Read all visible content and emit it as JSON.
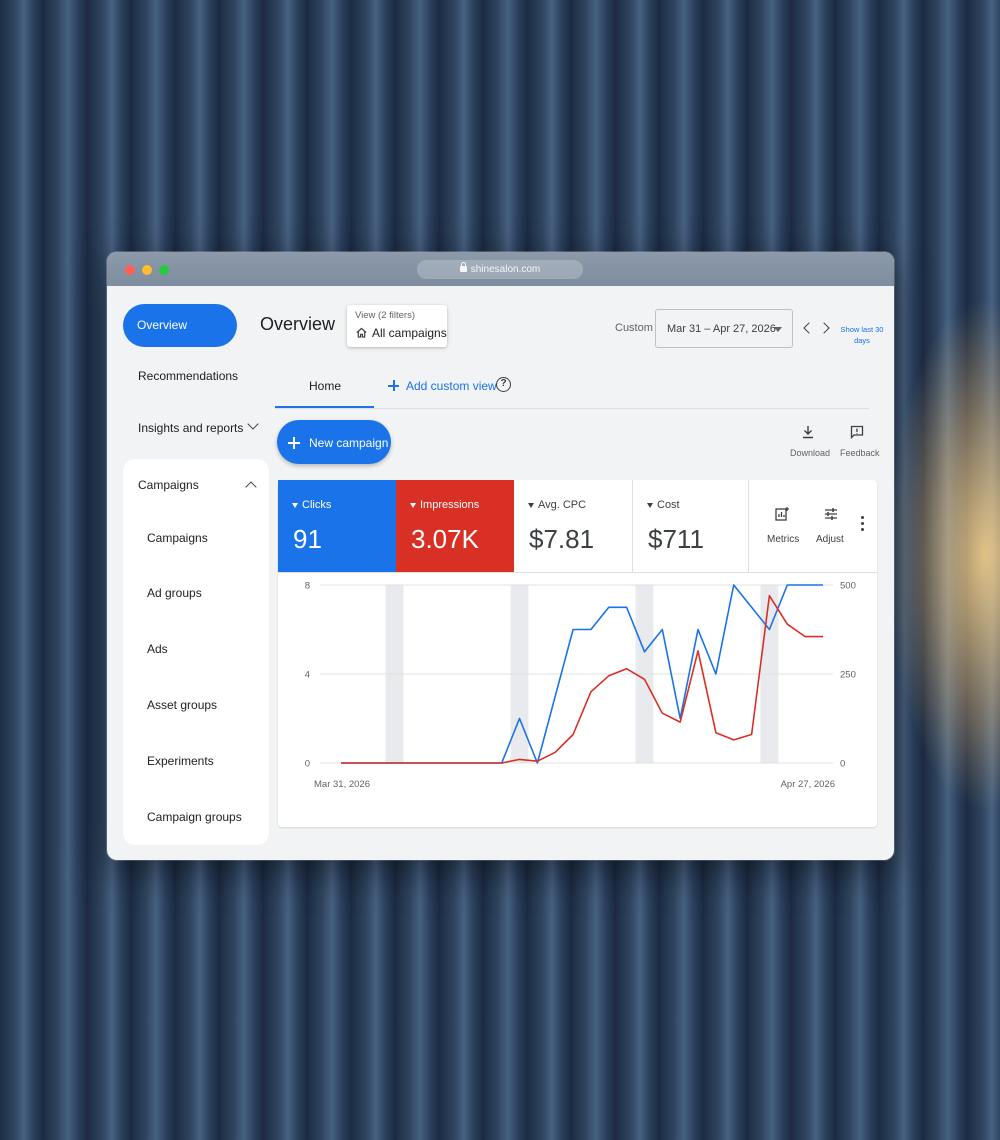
{
  "window": {
    "url": "shinesalon.com"
  },
  "sidebar": {
    "overview": "Overview",
    "recommendations": "Recommendations",
    "insights": "Insights and reports",
    "campaigns_header": "Campaigns",
    "items": [
      "Campaigns",
      "Ad groups",
      "Ads",
      "Asset groups",
      "Experiments",
      "Campaign groups"
    ]
  },
  "header": {
    "title": "Overview",
    "view_filters": "View (2 filters)",
    "view_name": "All campaigns",
    "custom_label": "Custom",
    "date_range": "Mar 31 – Apr 27, 2026",
    "show_last": "Show last 30 days"
  },
  "tabs": {
    "home": "Home",
    "add_custom_view": "Add custom view"
  },
  "actions": {
    "new_campaign": "New campaign",
    "download": "Download",
    "feedback": "Feedback"
  },
  "metrics": [
    {
      "name": "Clicks",
      "value": "91",
      "bg": "#1a73e8",
      "fg": "#ffffff"
    },
    {
      "name": "Impressions",
      "value": "3.07K",
      "bg": "#d93025",
      "fg": "#ffffff"
    },
    {
      "name": "Avg. CPC",
      "value": "$7.81",
      "bg": "#ffffff",
      "fg": "#3c4043"
    },
    {
      "name": "Cost",
      "value": "$711",
      "bg": "#ffffff",
      "fg": "#3c4043"
    }
  ],
  "tools": {
    "metrics": "Metrics",
    "adjust": "Adjust"
  },
  "colors": {
    "accent": "#1a73e8",
    "impressions": "#d93025"
  },
  "chart_data": {
    "type": "line",
    "x_start_label": "Mar 31, 2026",
    "x_end_label": "Apr 27, 2026",
    "x": [
      0,
      1,
      2,
      3,
      4,
      5,
      6,
      7,
      8,
      9,
      10,
      11,
      12,
      13,
      14,
      15,
      16,
      17,
      18,
      19,
      20,
      21,
      22,
      23,
      24,
      25,
      26,
      27
    ],
    "left_axis": {
      "ticks": [
        "0",
        "4",
        "8"
      ],
      "ylim": [
        0,
        8
      ]
    },
    "right_axis": {
      "ticks": [
        "0",
        "250",
        "500"
      ],
      "ylim": [
        0,
        500
      ]
    },
    "highlight_days": [
      3,
      10,
      17,
      24
    ],
    "series": [
      {
        "axis": "left",
        "color": "#1a73e8",
        "values": [
          0,
          0,
          0,
          0,
          0,
          0,
          0,
          0,
          0,
          0,
          2,
          0,
          3,
          6,
          6,
          7,
          7,
          5,
          6,
          2,
          6,
          4,
          8,
          7,
          6,
          8,
          8,
          8
        ]
      },
      {
        "axis": "right",
        "color": "#d93025",
        "values": [
          0,
          0,
          0,
          0,
          0,
          0,
          0,
          0,
          0,
          0,
          10,
          5,
          30,
          80,
          200,
          245,
          265,
          235,
          140,
          115,
          315,
          85,
          65,
          80,
          470,
          390,
          355,
          355
        ]
      }
    ]
  }
}
